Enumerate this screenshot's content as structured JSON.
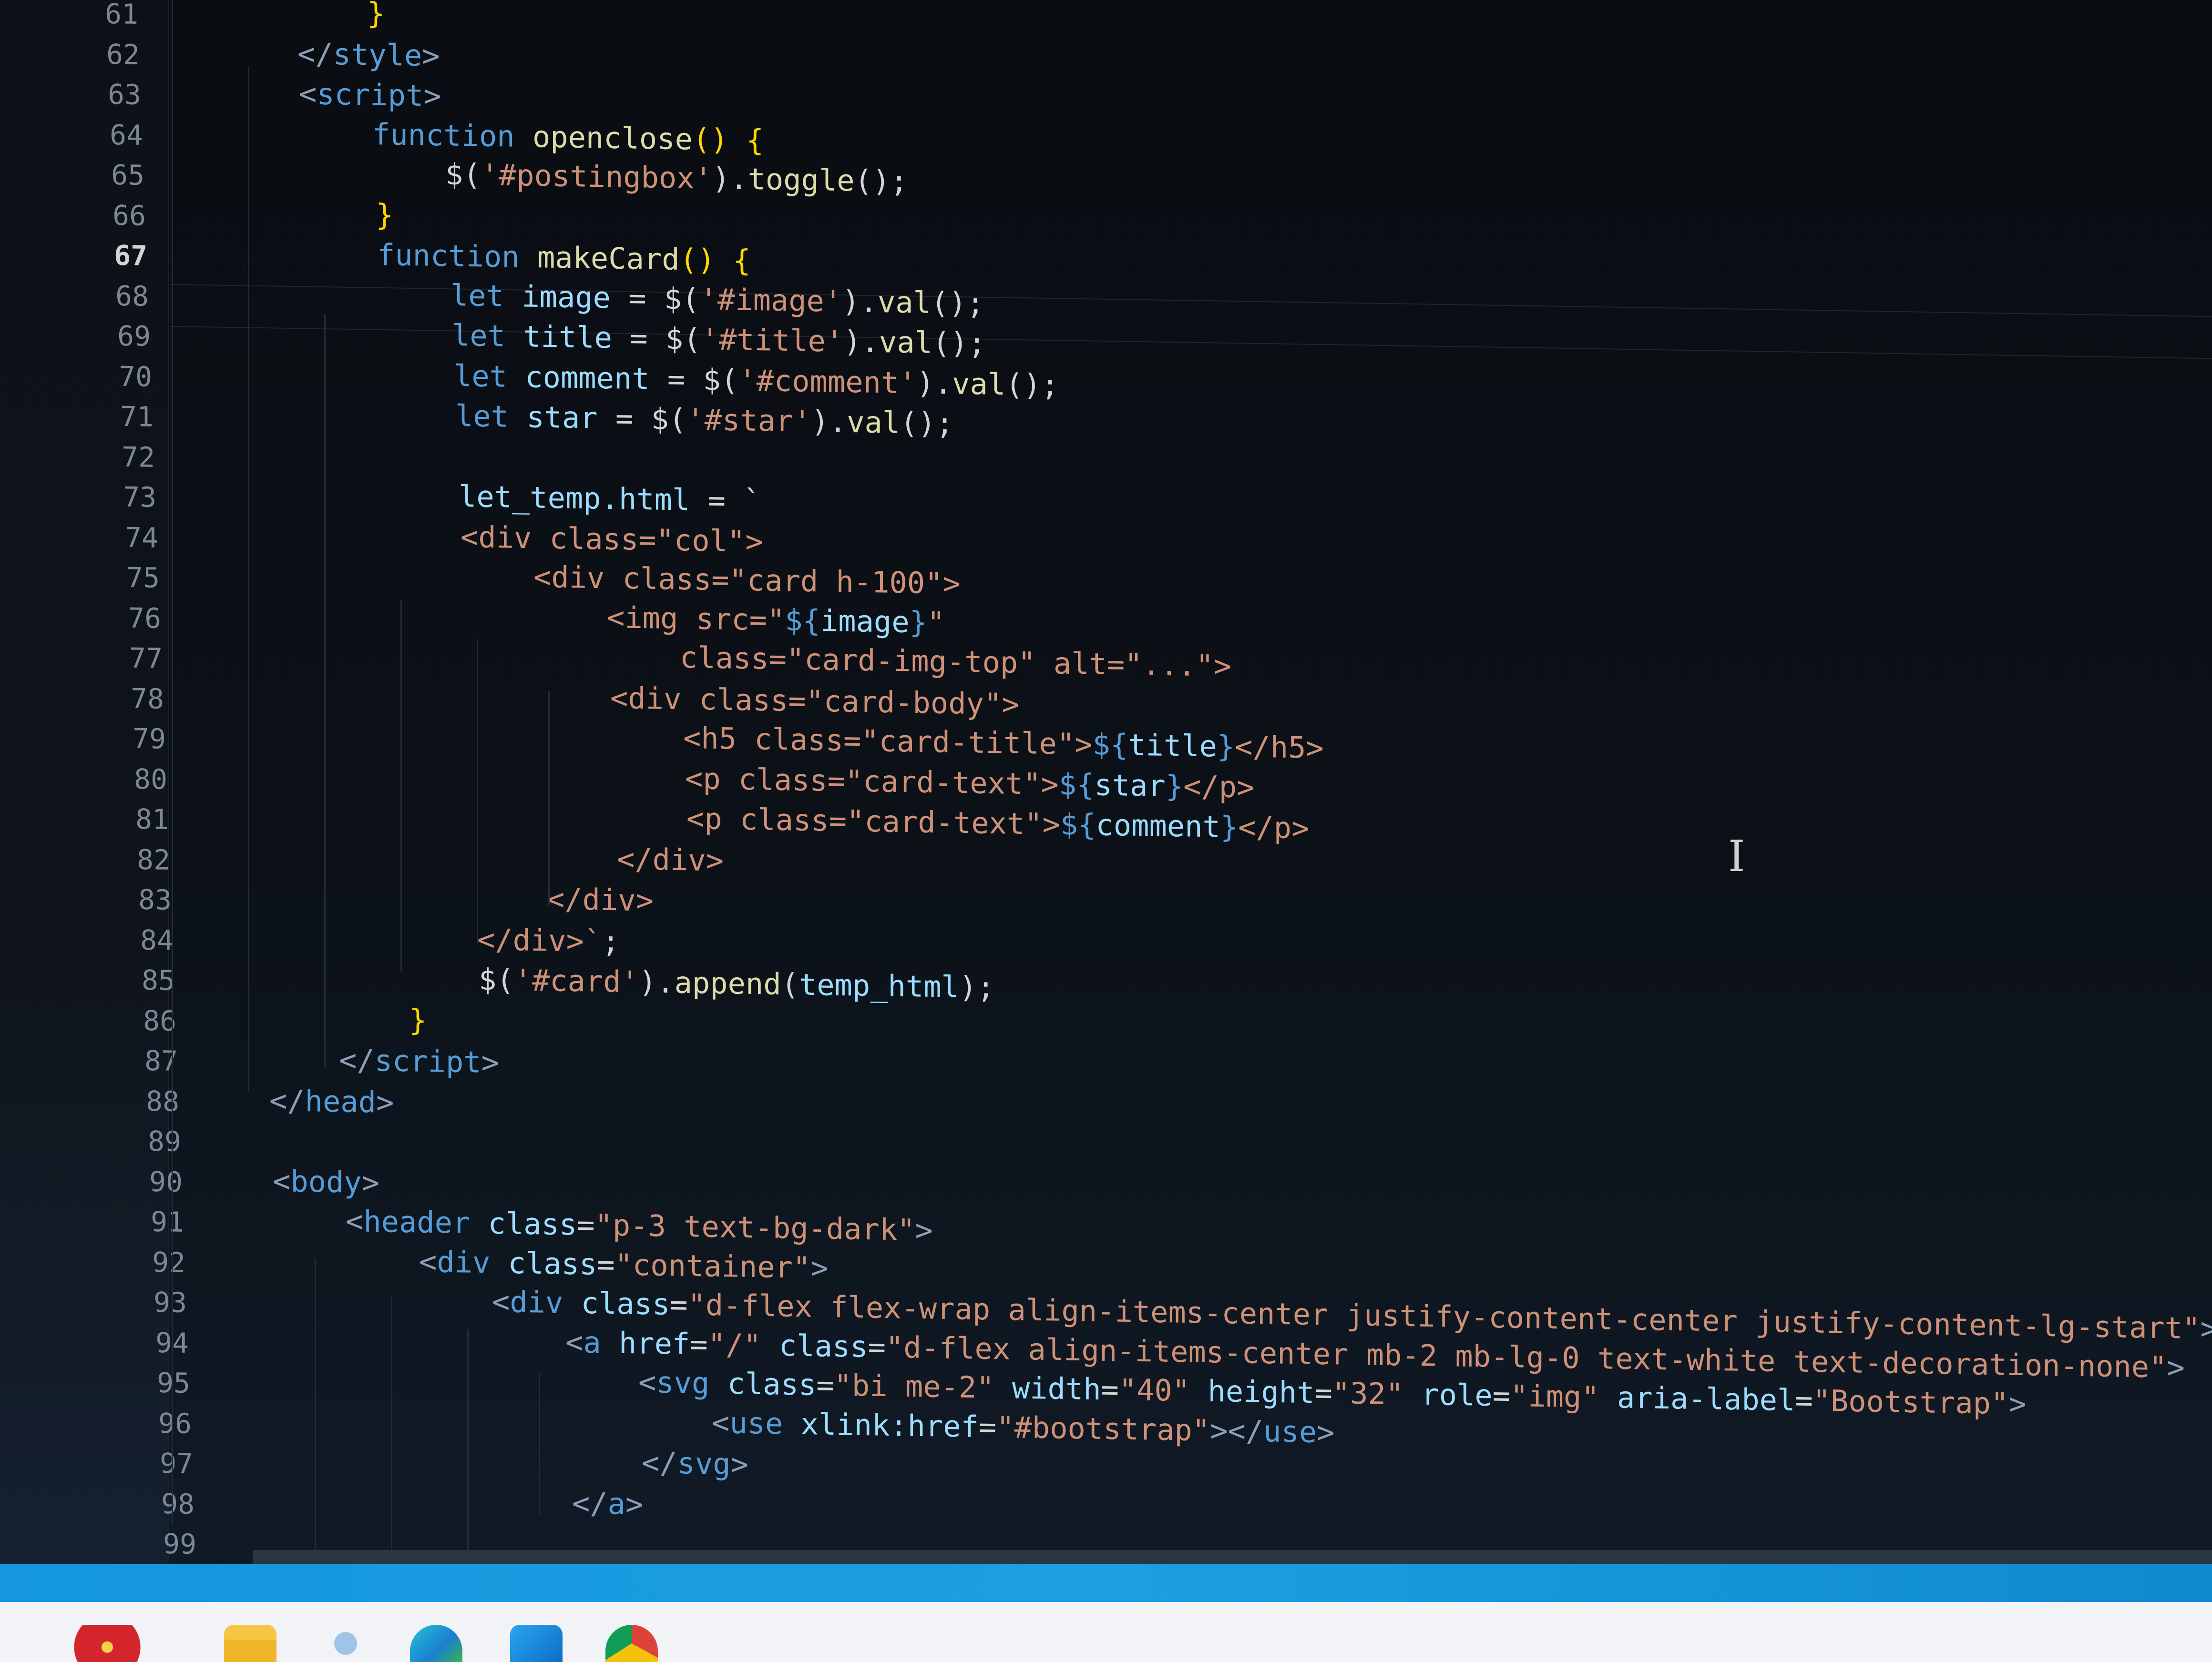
{
  "editor": {
    "current_line_number": "67",
    "line_numbers": [
      "61",
      "62",
      "63",
      "64",
      "65",
      "66",
      "67",
      "68",
      "69",
      "70",
      "71",
      "72",
      "73",
      "74",
      "75",
      "76",
      "77",
      "78",
      "79",
      "80",
      "81",
      "82",
      "83",
      "84",
      "85",
      "86",
      "87",
      "88",
      "89",
      "90",
      "91",
      "92",
      "93",
      "94",
      "95",
      "96",
      "97",
      "98",
      "99"
    ],
    "lines": [
      {
        "number": "61",
        "tokens": [
          {
            "t": "}",
            "c": "br"
          }
        ]
      },
      {
        "number": "62",
        "tokens": [
          {
            "t": "</",
            "c": "tag"
          },
          {
            "t": "style",
            "c": "tn"
          },
          {
            "t": ">",
            "c": "tag"
          }
        ]
      },
      {
        "number": "63",
        "tokens": [
          {
            "t": "<",
            "c": "tag"
          },
          {
            "t": "script",
            "c": "tn"
          },
          {
            "t": ">",
            "c": "tag"
          }
        ]
      },
      {
        "number": "64",
        "tokens": [
          {
            "t": "function ",
            "c": "kw"
          },
          {
            "t": "openclose",
            "c": "fn"
          },
          {
            "t": "() {",
            "c": "br"
          }
        ]
      },
      {
        "number": "65",
        "tokens": [
          {
            "t": "$(",
            "c": "pn"
          },
          {
            "t": "'#postingbox'",
            "c": "st"
          },
          {
            "t": ").",
            "c": "pn"
          },
          {
            "t": "toggle",
            "c": "fn"
          },
          {
            "t": "();",
            "c": "pn"
          }
        ]
      },
      {
        "number": "66",
        "tokens": [
          {
            "t": "}",
            "c": "br"
          }
        ]
      },
      {
        "number": "67",
        "tokens": [
          {
            "t": "function ",
            "c": "kw"
          },
          {
            "t": "makeCard",
            "c": "fn"
          },
          {
            "t": "() {",
            "c": "br"
          }
        ]
      },
      {
        "number": "68",
        "tokens": [
          {
            "t": "let ",
            "c": "kw"
          },
          {
            "t": "image",
            "c": "vr"
          },
          {
            "t": " = $(",
            "c": "pn"
          },
          {
            "t": "'#image'",
            "c": "st"
          },
          {
            "t": ").",
            "c": "pn"
          },
          {
            "t": "val",
            "c": "fn"
          },
          {
            "t": "();",
            "c": "pn"
          }
        ]
      },
      {
        "number": "69",
        "tokens": [
          {
            "t": "let ",
            "c": "kw"
          },
          {
            "t": "title",
            "c": "vr"
          },
          {
            "t": " = $(",
            "c": "pn"
          },
          {
            "t": "'#title'",
            "c": "st"
          },
          {
            "t": ").",
            "c": "pn"
          },
          {
            "t": "val",
            "c": "fn"
          },
          {
            "t": "();",
            "c": "pn"
          }
        ]
      },
      {
        "number": "70",
        "tokens": [
          {
            "t": "let ",
            "c": "kw"
          },
          {
            "t": "comment",
            "c": "vr"
          },
          {
            "t": " = $(",
            "c": "pn"
          },
          {
            "t": "'#comment'",
            "c": "st"
          },
          {
            "t": ").",
            "c": "pn"
          },
          {
            "t": "val",
            "c": "fn"
          },
          {
            "t": "();",
            "c": "pn"
          }
        ]
      },
      {
        "number": "71",
        "tokens": [
          {
            "t": "let ",
            "c": "kw"
          },
          {
            "t": "star",
            "c": "vr"
          },
          {
            "t": " = $(",
            "c": "pn"
          },
          {
            "t": "'#star'",
            "c": "st"
          },
          {
            "t": ").",
            "c": "pn"
          },
          {
            "t": "val",
            "c": "fn"
          },
          {
            "t": "();",
            "c": "pn"
          }
        ]
      },
      {
        "number": "72",
        "tokens": []
      },
      {
        "number": "73",
        "tokens": [
          {
            "t": "let_temp.html",
            "c": "vr"
          },
          {
            "t": " = `",
            "c": "pn"
          }
        ]
      },
      {
        "number": "74",
        "tokens": [
          {
            "t": "<div class=\"col\">",
            "c": "st"
          }
        ]
      },
      {
        "number": "75",
        "tokens": [
          {
            "t": "<div class=\"card h-100\">",
            "c": "st"
          }
        ]
      },
      {
        "number": "76",
        "tokens": [
          {
            "t": "<img src=\"",
            "c": "st"
          },
          {
            "t": "${",
            "c": "tp"
          },
          {
            "t": "image",
            "c": "vr"
          },
          {
            "t": "}",
            "c": "tp"
          },
          {
            "t": "\"",
            "c": "st"
          }
        ]
      },
      {
        "number": "77",
        "tokens": [
          {
            "t": "class=\"card-img-top\" alt=\"...\">",
            "c": "st"
          }
        ]
      },
      {
        "number": "78",
        "tokens": [
          {
            "t": "<div class=\"card-body\">",
            "c": "st"
          }
        ]
      },
      {
        "number": "79",
        "tokens": [
          {
            "t": "<h5 class=\"card-title\">",
            "c": "st"
          },
          {
            "t": "${",
            "c": "tp"
          },
          {
            "t": "title",
            "c": "vr"
          },
          {
            "t": "}",
            "c": "tp"
          },
          {
            "t": "</h5>",
            "c": "st"
          }
        ]
      },
      {
        "number": "80",
        "tokens": [
          {
            "t": "<p class=\"card-text\">",
            "c": "st"
          },
          {
            "t": "${",
            "c": "tp"
          },
          {
            "t": "star",
            "c": "vr"
          },
          {
            "t": "}",
            "c": "tp"
          },
          {
            "t": "</p>",
            "c": "st"
          }
        ]
      },
      {
        "number": "81",
        "tokens": [
          {
            "t": "<p class=\"card-text\">",
            "c": "st"
          },
          {
            "t": "${",
            "c": "tp"
          },
          {
            "t": "comment",
            "c": "vr"
          },
          {
            "t": "}",
            "c": "tp"
          },
          {
            "t": "</p>",
            "c": "st"
          }
        ]
      },
      {
        "number": "82",
        "tokens": [
          {
            "t": "</div>",
            "c": "st"
          }
        ]
      },
      {
        "number": "83",
        "tokens": [
          {
            "t": "</div>",
            "c": "st"
          }
        ]
      },
      {
        "number": "84",
        "tokens": [
          {
            "t": "</div>`",
            "c": "st"
          },
          {
            "t": ";",
            "c": "pn"
          }
        ]
      },
      {
        "number": "85",
        "tokens": [
          {
            "t": "$(",
            "c": "pn"
          },
          {
            "t": "'#card'",
            "c": "st"
          },
          {
            "t": ").",
            "c": "pn"
          },
          {
            "t": "append",
            "c": "fn"
          },
          {
            "t": "(",
            "c": "pn"
          },
          {
            "t": "temp_html",
            "c": "vr"
          },
          {
            "t": ");",
            "c": "pn"
          }
        ]
      },
      {
        "number": "86",
        "tokens": [
          {
            "t": "}",
            "c": "br"
          }
        ]
      },
      {
        "number": "87",
        "tokens": [
          {
            "t": "</",
            "c": "tag"
          },
          {
            "t": "script",
            "c": "tn"
          },
          {
            "t": ">",
            "c": "tag"
          }
        ]
      },
      {
        "number": "88",
        "tokens": [
          {
            "t": "</",
            "c": "tag"
          },
          {
            "t": "head",
            "c": "tn"
          },
          {
            "t": ">",
            "c": "tag"
          }
        ]
      },
      {
        "number": "89",
        "tokens": []
      },
      {
        "number": "90",
        "tokens": [
          {
            "t": "<",
            "c": "tag"
          },
          {
            "t": "body",
            "c": "tn"
          },
          {
            "t": ">",
            "c": "tag"
          }
        ]
      },
      {
        "number": "91",
        "tokens": [
          {
            "t": "<",
            "c": "tag"
          },
          {
            "t": "header ",
            "c": "tn"
          },
          {
            "t": "class",
            "c": "at"
          },
          {
            "t": "=",
            "c": "pn"
          },
          {
            "t": "\"p-3 text-bg-dark\"",
            "c": "st"
          },
          {
            "t": ">",
            "c": "tag"
          }
        ]
      },
      {
        "number": "92",
        "tokens": [
          {
            "t": "<",
            "c": "tag"
          },
          {
            "t": "div ",
            "c": "tn"
          },
          {
            "t": "class",
            "c": "at"
          },
          {
            "t": "=",
            "c": "pn"
          },
          {
            "t": "\"container\"",
            "c": "st"
          },
          {
            "t": ">",
            "c": "tag"
          }
        ]
      },
      {
        "number": "93",
        "tokens": [
          {
            "t": "<",
            "c": "tag"
          },
          {
            "t": "div ",
            "c": "tn"
          },
          {
            "t": "class",
            "c": "at"
          },
          {
            "t": "=",
            "c": "pn"
          },
          {
            "t": "\"d-flex flex-wrap align-items-center justify-content-center justify-content-lg-start\"",
            "c": "st"
          },
          {
            "t": ">",
            "c": "tag"
          }
        ]
      },
      {
        "number": "94",
        "tokens": [
          {
            "t": "<",
            "c": "tag"
          },
          {
            "t": "a ",
            "c": "tn"
          },
          {
            "t": "href",
            "c": "at"
          },
          {
            "t": "=",
            "c": "pn"
          },
          {
            "t": "\"/\" ",
            "c": "st"
          },
          {
            "t": "class",
            "c": "at"
          },
          {
            "t": "=",
            "c": "pn"
          },
          {
            "t": "\"d-flex align-items-center mb-2 mb-lg-0 text-white text-decoration-none\"",
            "c": "st"
          },
          {
            "t": ">",
            "c": "tag"
          }
        ]
      },
      {
        "number": "95",
        "tokens": [
          {
            "t": "<",
            "c": "tag"
          },
          {
            "t": "svg ",
            "c": "tn"
          },
          {
            "t": "class",
            "c": "at"
          },
          {
            "t": "=",
            "c": "pn"
          },
          {
            "t": "\"bi me-2\" ",
            "c": "st"
          },
          {
            "t": "width",
            "c": "at"
          },
          {
            "t": "=",
            "c": "pn"
          },
          {
            "t": "\"40\" ",
            "c": "st"
          },
          {
            "t": "height",
            "c": "at"
          },
          {
            "t": "=",
            "c": "pn"
          },
          {
            "t": "\"32\" ",
            "c": "st"
          },
          {
            "t": "role",
            "c": "at"
          },
          {
            "t": "=",
            "c": "pn"
          },
          {
            "t": "\"img\" ",
            "c": "st"
          },
          {
            "t": "aria-label",
            "c": "at"
          },
          {
            "t": "=",
            "c": "pn"
          },
          {
            "t": "\"Bootstrap\"",
            "c": "st"
          },
          {
            "t": ">",
            "c": "tag"
          }
        ]
      },
      {
        "number": "96",
        "tokens": [
          {
            "t": "<",
            "c": "tag"
          },
          {
            "t": "use ",
            "c": "tn"
          },
          {
            "t": "xlink:href",
            "c": "at"
          },
          {
            "t": "=",
            "c": "pn"
          },
          {
            "t": "\"#bootstrap\"",
            "c": "st"
          },
          {
            "t": "></",
            "c": "tag"
          },
          {
            "t": "use",
            "c": "tn"
          },
          {
            "t": ">",
            "c": "tag"
          }
        ]
      },
      {
        "number": "97",
        "tokens": [
          {
            "t": "</",
            "c": "tag"
          },
          {
            "t": "svg",
            "c": "tn"
          },
          {
            "t": ">",
            "c": "tag"
          }
        ]
      },
      {
        "number": "98",
        "tokens": [
          {
            "t": "</",
            "c": "tag"
          },
          {
            "t": "a",
            "c": "tn"
          },
          {
            "t": ">",
            "c": "tag"
          }
        ]
      },
      {
        "number": "99",
        "tokens": []
      }
    ]
  },
  "taskbar": {
    "icons": [
      "poinsettia-wallpaper-icon",
      "file-explorer-icon",
      "snipping-tool-icon",
      "edge-browser-icon",
      "vscode-icon",
      "chrome-icon"
    ]
  },
  "colors": {
    "editor_bg": "#0b0f14",
    "keyword": "#569cd6",
    "string": "#ce9178",
    "function": "#dcdcaa",
    "variable": "#9cdcfe",
    "bracket": "#ffd700",
    "accent_band": "#1497dd",
    "taskbar_bg": "#f1f3f6"
  }
}
